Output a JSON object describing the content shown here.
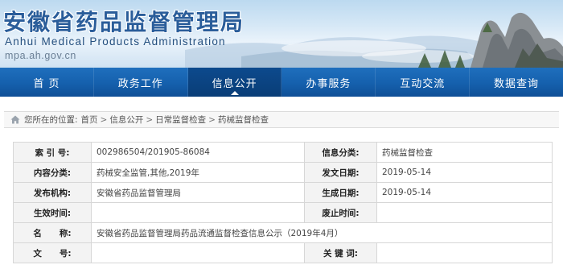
{
  "header": {
    "title_cn": "安徽省药品监督管理局",
    "title_en": "Anhui Medical Products Administration",
    "url": "mpa.ah.gov.cn"
  },
  "nav": {
    "items": [
      {
        "label": "首 页"
      },
      {
        "label": "政务工作"
      },
      {
        "label": "信息公开",
        "active": true
      },
      {
        "label": "办事服务"
      },
      {
        "label": "互动交流"
      },
      {
        "label": "数据查询"
      }
    ]
  },
  "breadcrumb": {
    "prefix": "您所在的位置:",
    "items": [
      "首页",
      "信息公开",
      "日常监督检查",
      "药械监督检查"
    ],
    "separator": ">"
  },
  "info": {
    "index_label": "索 引 号:",
    "index_value": "002986504/201905-86084",
    "category_label": "信息分类:",
    "category_value": "药械监督检查",
    "content_label": "内容分类:",
    "content_value": "药械安全监管,其他,2019年",
    "publish_date_label": "发文日期:",
    "publish_date_value": "2019-05-14",
    "issuer_label": "发布机构:",
    "issuer_value": "安徽省药品监督管理局",
    "generate_date_label": "生成日期:",
    "generate_date_value": "2019-05-14",
    "effective_label": "生效时间:",
    "effective_value": "",
    "repeal_label": "废止时间:",
    "repeal_value": "",
    "name_label": "名      称:",
    "name_value": "安徽省药品监督管理局药品流通监督检查信息公示（2019年4月）",
    "doc_no_label": "文      号:",
    "doc_no_value": "",
    "keywords_label": "关 键 词:",
    "keywords_value": ""
  },
  "colors": {
    "nav_blue": "#1560ad",
    "nav_active": "#0d4a8d",
    "title_blue": "#2a5d9a"
  }
}
